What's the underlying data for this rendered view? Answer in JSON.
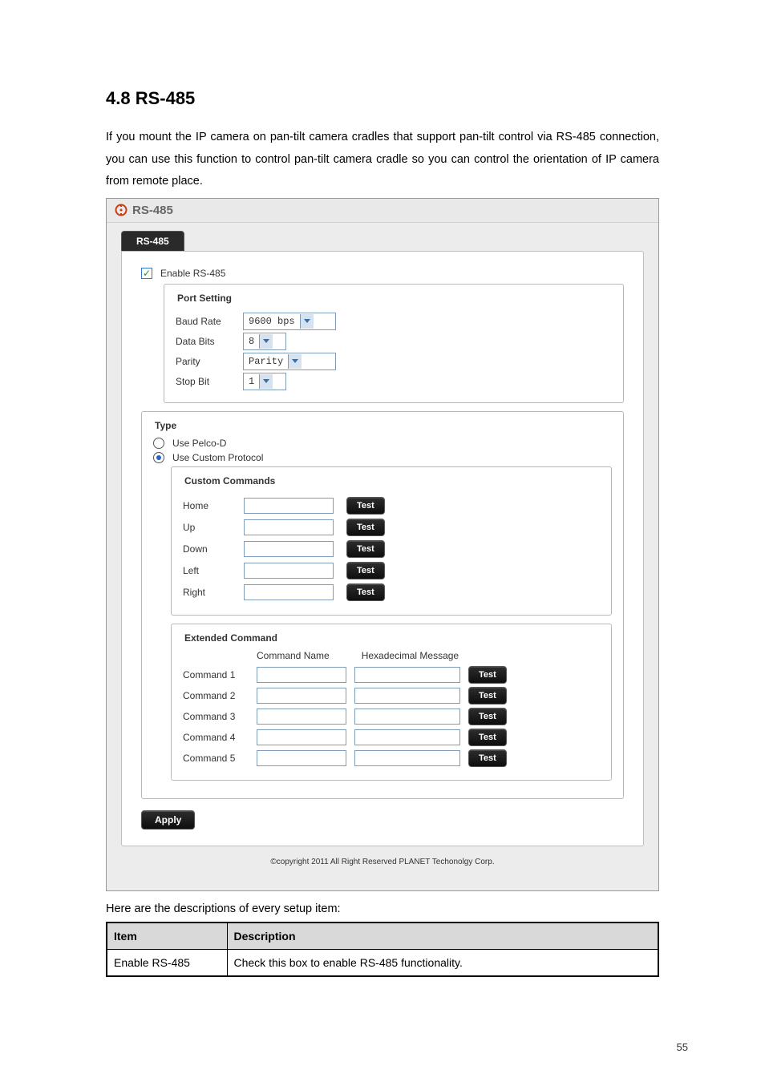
{
  "section": {
    "heading": "4.8 RS-485",
    "intro": "If you mount the IP camera on pan-tilt camera cradles that support pan-tilt control via RS-485 connection, you can use this function to control pan-tilt camera cradle so you can control the orientation of IP camera from remote place."
  },
  "shot": {
    "title": "RS-485",
    "tab": "RS-485",
    "enable_label": "Enable RS-485",
    "port_setting_legend": "Port Setting",
    "baud_label": "Baud Rate",
    "baud_value": "9600 bps",
    "data_bits_label": "Data Bits",
    "data_bits_value": "8",
    "parity_label": "Parity",
    "parity_value": "Parity",
    "stop_bit_label": "Stop Bit",
    "stop_bit_value": "1",
    "type_legend": "Type",
    "use_pelco_label": "Use Pelco-D",
    "use_custom_label": "Use Custom Protocol",
    "custom_legend": "Custom Commands",
    "cc": {
      "home": "Home",
      "up": "Up",
      "down": "Down",
      "left": "Left",
      "right": "Right"
    },
    "ext_legend": "Extended Command",
    "ext_head_name": "Command Name",
    "ext_head_hex": "Hexadecimal Message",
    "ext_rows": [
      "Command 1",
      "Command 2",
      "Command 3",
      "Command 4",
      "Command 5"
    ],
    "test_label": "Test",
    "apply_label": "Apply",
    "copyright": "©copyright 2011 All Right Reserved PLANET Techonolgy Corp."
  },
  "desc_caption": "Here are the descriptions of every setup item:",
  "table": {
    "head_item": "Item",
    "head_desc": "Description",
    "row1_item": "Enable RS-485",
    "row1_desc": "Check this box to enable RS-485 functionality."
  },
  "page_number": "55"
}
